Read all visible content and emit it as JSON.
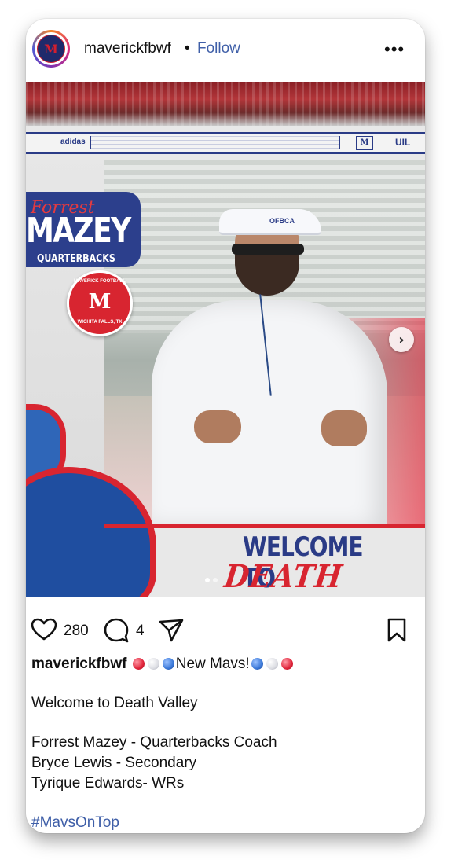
{
  "post": {
    "username": "maverickfbwf",
    "separator": "•",
    "follow_label": "Follow",
    "more_icon": "more-dots-icon",
    "avatar_text": "M"
  },
  "image": {
    "banner_left": "adidas",
    "banner_right": "UIL",
    "banner_logo": "M",
    "name_script": "Forrest",
    "name_main": "MAZEY",
    "name_sub": "QUARTERBACKS",
    "badge_top": "MAVERICK FOOTBALL",
    "badge_letter": "M",
    "badge_bottom": "WICHITA FALLS, TX",
    "visor_text": "OFBCA",
    "welcome": "WELCOME TO",
    "death_valley": "DEATH VALLEY"
  },
  "actions": {
    "like_count": "280",
    "comment_count": "4"
  },
  "caption": {
    "username": "maverickfbwf",
    "headline": "New Mavs!",
    "line_welcome": "Welcome to Death Valley",
    "coach1": "Forrest Mazey - Quarterbacks Coach",
    "coach2": "Bryce Lewis - Secondary",
    "coach3": "Tyrique Edwards- WRs",
    "hashtag": "#MavsOnTop"
  },
  "colors": {
    "follow": "#3f5fa8",
    "brand_blue": "#2a3b86",
    "brand_red": "#d82530"
  }
}
